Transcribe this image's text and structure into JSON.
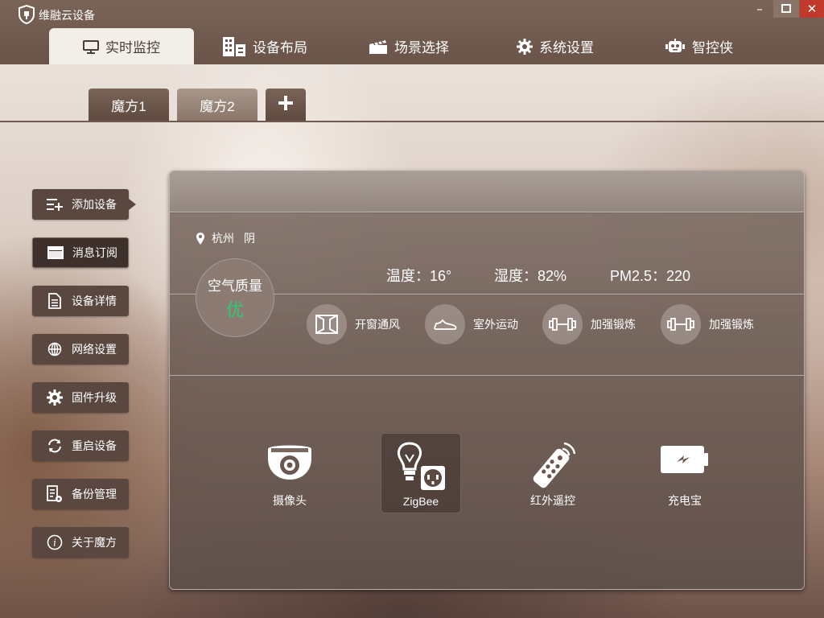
{
  "app": {
    "title": "维融云设备"
  },
  "window_controls": {
    "minimize": "–",
    "close": "✕"
  },
  "main_tabs": [
    {
      "label": "实时监控",
      "icon": "monitor-icon",
      "active": true
    },
    {
      "label": "设备布局",
      "icon": "building-icon"
    },
    {
      "label": "场景选择",
      "icon": "clapperboard-icon"
    },
    {
      "label": "系统设置",
      "icon": "gear-icon"
    },
    {
      "label": "智控侠",
      "icon": "robot-icon"
    }
  ],
  "sub_tabs": [
    {
      "label": "魔方1",
      "active": true
    },
    {
      "label": "魔方2"
    }
  ],
  "add_tab": "+",
  "sidebar": [
    {
      "label": "添加设备",
      "icon": "add-list-icon",
      "active": true
    },
    {
      "label": "消息订阅",
      "icon": "window-icon"
    },
    {
      "label": "设备详情",
      "icon": "document-icon"
    },
    {
      "label": "网络设置",
      "icon": "globe-icon"
    },
    {
      "label": "固件升级",
      "icon": "gear-icon"
    },
    {
      "label": "重启设备",
      "icon": "refresh-icon"
    },
    {
      "label": "备份管理",
      "icon": "backup-icon"
    },
    {
      "label": "关于魔方",
      "icon": "info-icon"
    }
  ],
  "weather": {
    "city": "杭州",
    "condition": "阴",
    "air_quality_label": "空气质量",
    "air_quality_value": "优",
    "temperature": "温度：16°",
    "humidity": "湿度：82%",
    "pm25": "PM2.5：220"
  },
  "suggestions": [
    {
      "label": "开窗通风",
      "icon": "window-open-icon"
    },
    {
      "label": "室外运动",
      "icon": "shoe-icon"
    },
    {
      "label": "加强锻炼",
      "icon": "dumbbell-icon"
    },
    {
      "label": "加强锻炼",
      "icon": "dumbbell-icon"
    }
  ],
  "devices": [
    {
      "label": "摄像头",
      "icon": "camera-icon"
    },
    {
      "label": "ZigBee",
      "icon": "zigbee-icon",
      "selected": true
    },
    {
      "label": "红外遥控",
      "icon": "remote-icon"
    },
    {
      "label": "充电宝",
      "icon": "battery-icon"
    }
  ],
  "colors": {
    "titlebar": "#6a5449",
    "air_quality_good": "#2ecc71",
    "close_button": "#c0392b"
  }
}
